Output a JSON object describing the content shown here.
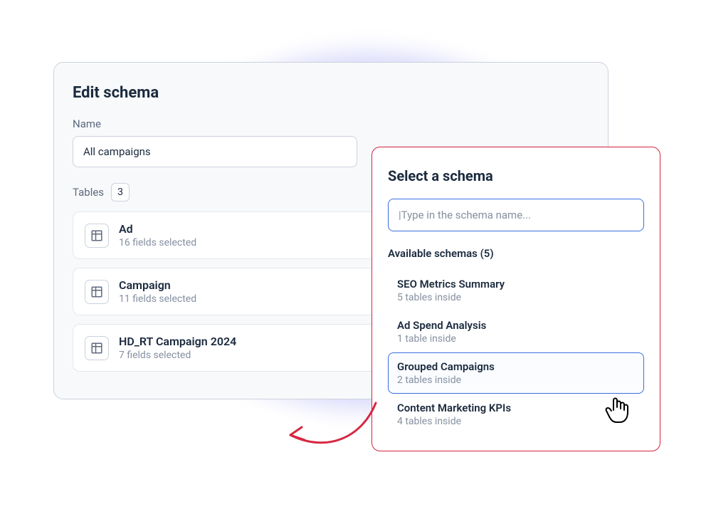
{
  "edit": {
    "title": "Edit schema",
    "name_label": "Name",
    "name_value": "All campaigns",
    "tables_label": "Tables",
    "tables_count": "3",
    "tables": [
      {
        "name": "Ad",
        "sub": "16 fields selected"
      },
      {
        "name": "Campaign",
        "sub": "11 fields selected"
      },
      {
        "name": "HD_RT Campaign 2024",
        "sub": "7 fields selected"
      }
    ]
  },
  "select": {
    "title": "Select a schema",
    "search_placeholder": "|Type in the schema name...",
    "available_label": "Available schemas (5)",
    "schemas": [
      {
        "name": "SEO Metrics Summary",
        "sub": "5 tables inside",
        "highlighted": false
      },
      {
        "name": "Ad Spend Analysis",
        "sub": "1 table inside",
        "highlighted": false
      },
      {
        "name": "Grouped Campaigns",
        "sub": "2 tables inside",
        "highlighted": true
      },
      {
        "name": "Content Marketing KPIs",
        "sub": "4 tables inside",
        "highlighted": false
      }
    ]
  }
}
